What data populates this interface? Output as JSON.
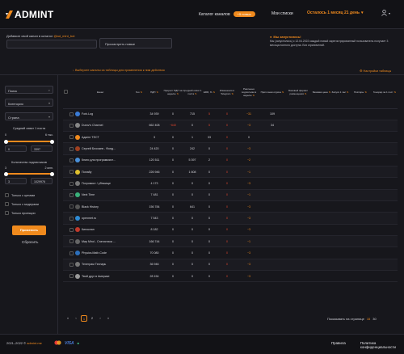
{
  "brand": {
    "name": "ADMINT",
    "accent": "#f08a1d"
  },
  "header": {
    "catalog": "Каталог каналов",
    "catalog_badge": "+5 новых",
    "my_lists": "Мои списки",
    "remain": "Осталось 1 месяц 21 день"
  },
  "add": {
    "label_prefix": "Добавьте свой канал в каталог",
    "label_handle": "@ad_mint_bot",
    "input_placeholder": "",
    "input_hint": "",
    "button_placeholder": "Просмотреть новые"
  },
  "notice": {
    "title": "Мы запустились!",
    "text": "Мы (запустились) с 12.04.2022 каждый новый зарегистрированный пользователь получает 3 месяца полного доступа. Без ограничений."
  },
  "toolbar": {
    "filters": "Выберите каналы из таблицы для применения к ним действия",
    "table_settings": "Настройки таблицы"
  },
  "sidebar": {
    "search": "Поиск",
    "category": "Категория",
    "country": "Страна",
    "avg_reach_label": "Средний охват 1 поста",
    "avg_min": "0",
    "avg_max": "6 тыс.",
    "avg_from": "0",
    "avg_to": "3397",
    "subs_label": "Количество подписчиков",
    "subs_min": "3",
    "subs_max": "2 млн.",
    "subs_from": "3",
    "subs_to": "1029976",
    "checks": [
      "Только с ценами",
      "Только с модерами",
      "Только проекции"
    ],
    "apply": "Применить",
    "reset": "Сбросить"
  },
  "table": {
    "columns": [
      "",
      "Канал",
      "Гео",
      "ПДП",
      "Прирост ПДП за неделю",
      "Средний охват 1 поста",
      "ERR, %",
      "Изменения в Telegram",
      "Реальные подписчики в неделю",
      "Приточная отдача",
      "Базовый формат размещения",
      "Базовая цена",
      "Запуск 1 час",
      "Повторы",
      "Гонорар за 1 пост"
    ],
    "rows": [
      {
        "name": "Fork.Log",
        "geo": "",
        "pdp": "34 939",
        "gain": "0",
        "reach": "715",
        "err": "5",
        "tg": "0",
        "real": "−31",
        "flow": "109",
        "fmt": "",
        "price": "",
        "start": "",
        "rep": "",
        "fee": "",
        "c": "#3a7bd5"
      },
      {
        "name": "Durov's Channel",
        "geo": "",
        "pdp": "662 408",
        "gain": "−640",
        "reach": "0",
        "err": "5",
        "tg": "0",
        "real": "−3",
        "flow": "34",
        "fmt": "",
        "price": "",
        "start": "",
        "rep": "",
        "fee": "",
        "c": "#888"
      },
      {
        "name": "Адмінт ТЕСТ",
        "geo": "",
        "pdp": "3",
        "gain": "0",
        "reach": "1",
        "err": "33",
        "tg": "0",
        "real": "0",
        "flow": "",
        "fmt": "",
        "price": "",
        "start": "",
        "rep": "",
        "fee": "",
        "c": "#f08a1d"
      },
      {
        "name": "Сергей Блохаев - Фонд...",
        "geo": "",
        "pdp": "24 420",
        "gain": "0",
        "reach": "242",
        "err": "0",
        "tg": "0",
        "real": "−3",
        "flow": "",
        "fmt": "",
        "price": "",
        "start": "",
        "rep": "",
        "fee": "",
        "c": "#a04020"
      },
      {
        "name": "Книги для программист...",
        "geo": "",
        "pdp": "120 511",
        "gain": "0",
        "reach": "5 397",
        "err": "2",
        "tg": "0",
        "real": "−2",
        "flow": "",
        "fmt": "",
        "price": "",
        "start": "",
        "rep": "",
        "fee": "",
        "c": "#4a90d9"
      },
      {
        "name": "Понайу",
        "geo": "",
        "pdp": "226 946",
        "gain": "0",
        "reach": "1 608",
        "err": "0",
        "tg": "0",
        "real": "−1",
        "flow": "",
        "fmt": "",
        "price": "",
        "start": "",
        "rep": "",
        "fee": "",
        "c": "#e0c02e"
      },
      {
        "name": "Погромист / убежище",
        "geo": "",
        "pdp": "4 173",
        "gain": "0",
        "reach": "0",
        "err": "0",
        "tg": "0",
        "real": "−3",
        "flow": "",
        "fmt": "",
        "price": "",
        "start": "",
        "rep": "",
        "fee": "",
        "c": "#777"
      },
      {
        "name": "Next Time",
        "geo": "",
        "pdp": "7 481",
        "gain": "0",
        "reach": "0",
        "err": "0",
        "tg": "0",
        "real": "−1",
        "flow": "",
        "fmt": "",
        "price": "",
        "start": "",
        "rep": "",
        "fee": "",
        "c": "#3ab07a"
      },
      {
        "name": "Black History",
        "geo": "",
        "pdp": "156 784",
        "gain": "0",
        "reach": "641",
        "err": "0",
        "tg": "0",
        "real": "−3",
        "flow": "",
        "fmt": "",
        "price": "",
        "start": "",
        "rep": "",
        "fee": "",
        "c": "#555"
      },
      {
        "name": "openmet.ru",
        "geo": "",
        "pdp": "7 543",
        "gain": "0",
        "reach": "0",
        "err": "0",
        "tg": "0",
        "real": "−3",
        "flow": "",
        "fmt": "",
        "price": "",
        "start": "",
        "rep": "",
        "fee": "",
        "c": "#2e8bd5"
      },
      {
        "name": "Киноклан",
        "geo": "",
        "pdp": "8 182",
        "gain": "0",
        "reach": "0",
        "err": "0",
        "tg": "0",
        "real": "−3",
        "flow": "",
        "fmt": "",
        "price": "",
        "start": "",
        "rep": "",
        "fee": "",
        "c": "#c0392b"
      },
      {
        "name": "Мир Mind - Статистика ...",
        "geo": "",
        "pdp": "166 744",
        "gain": "0",
        "reach": "0",
        "err": "0",
        "tg": "0",
        "real": "−1",
        "flow": "",
        "fmt": "",
        "price": "",
        "start": "",
        "rep": "",
        "fee": "",
        "c": "#666"
      },
      {
        "name": "Physics.Math.Code",
        "geo": "",
        "pdp": "70 080",
        "gain": "0",
        "reach": "0",
        "err": "0",
        "tg": "0",
        "real": "−3",
        "flow": "",
        "fmt": "",
        "price": "",
        "start": "",
        "rep": "",
        "fee": "",
        "c": "#2c6fbb"
      },
      {
        "name": "Телеграм Технарь",
        "geo": "",
        "pdp": "36 946",
        "gain": "0",
        "reach": "0",
        "err": "0",
        "tg": "0",
        "real": "−3",
        "flow": "",
        "fmt": "",
        "price": "",
        "start": "",
        "rep": "",
        "fee": "",
        "c": "#777"
      },
      {
        "name": "Твой друг в Америке",
        "geo": "",
        "pdp": "28 154",
        "gain": "0",
        "reach": "0",
        "err": "0",
        "tg": "0",
        "real": "−3",
        "flow": "",
        "fmt": "",
        "price": "",
        "start": "",
        "rep": "",
        "fee": "",
        "c": "#999"
      }
    ]
  },
  "pagination": {
    "pages": [
      "1",
      "2"
    ],
    "current": "1",
    "perpage_label": "Показывать на странице",
    "perpage_options": [
      "15",
      "30"
    ]
  },
  "footer": {
    "copyright": "2021–2022 ©",
    "site": "admint.me",
    "links": [
      "Правила",
      "Политика конфиденциальности"
    ]
  }
}
